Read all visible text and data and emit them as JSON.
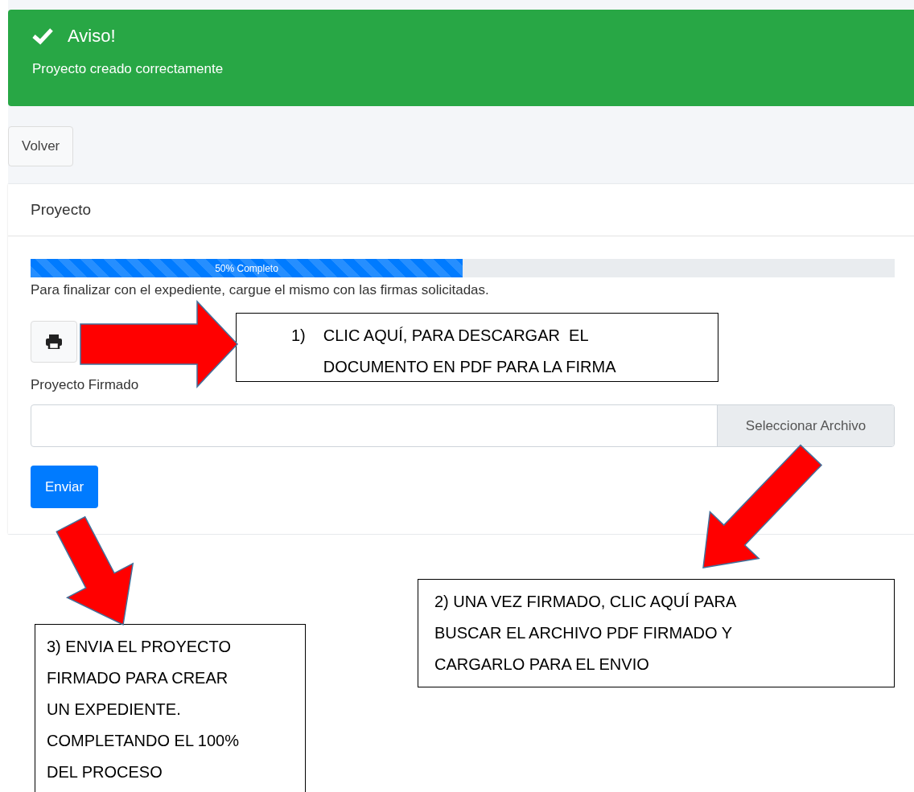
{
  "alert": {
    "title": "Aviso!",
    "message": "Proyecto creado correctamente"
  },
  "back_button": "Volver",
  "card": {
    "title": "Proyecto",
    "progress": {
      "level": 0.5,
      "label": "50% Completo"
    },
    "instructions": "Para finalizar con el expediente, cargue el mismo con las firmas solicitadas.",
    "file_field": {
      "label": "Proyecto Firmado",
      "button": "Seleccionar Archivo"
    },
    "submit_button": "Enviar"
  },
  "annotations": [
    {
      "kind": "numbered",
      "number": "1)",
      "text": "CLIC AQUÍ, PARA DESCARGAR  EL DOCUMENTO EN PDF PARA LA FIRMA"
    },
    {
      "kind": "plain",
      "text": "2) UNA VEZ FIRMADO, CLIC AQUÍ PARA BUSCAR EL ARCHIVO PDF FIRMADO Y CARGARLO PARA EL ENVIO"
    },
    {
      "kind": "plain",
      "text": "3) ENVIA EL PROYECTO FIRMADO PARA CREAR UN EXPEDIENTE. COMPLETANDO EL 100% DEL PROCESO"
    }
  ]
}
